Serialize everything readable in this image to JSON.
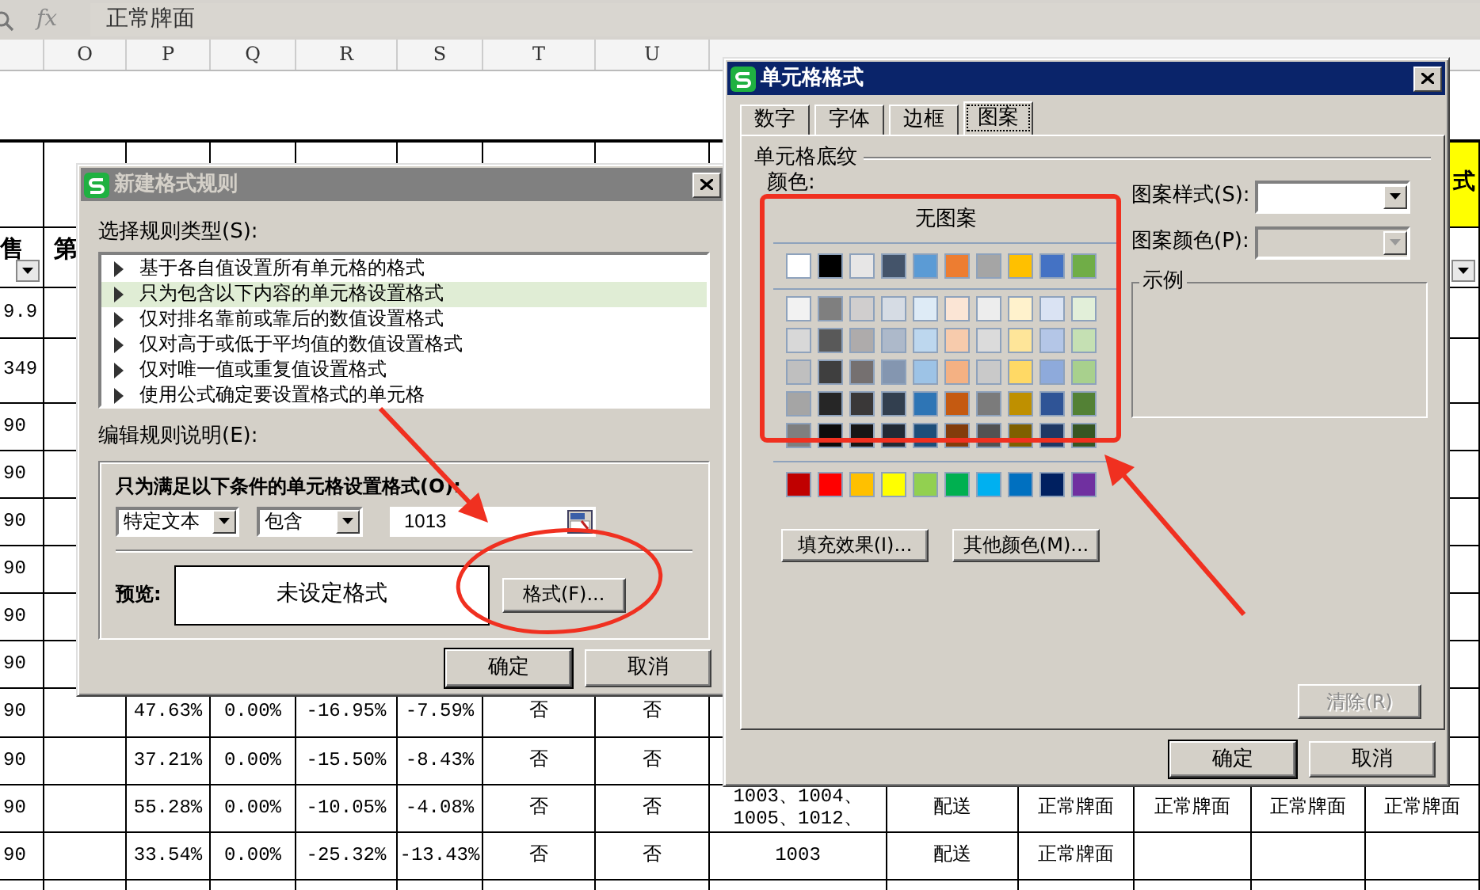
{
  "formula_bar": {
    "fx_label": "fx",
    "cell_value": "正常牌面"
  },
  "column_headers": [
    "O",
    "P",
    "Q",
    "R",
    "S",
    "T",
    "U"
  ],
  "sheet_rows": [
    {
      "kind": "data",
      "cells": [
        null,
        null,
        null,
        null,
        null,
        null,
        null,
        null,
        null,
        null,
        null,
        null,
        null,
        {
          "text": "式",
          "highlight": true
        }
      ]
    },
    {
      "kind": "header",
      "cells": [
        {
          "text": "售",
          "filter_button": true
        },
        {
          "text": "第",
          "filter_button": false
        },
        null,
        null,
        null,
        null,
        null,
        null,
        null,
        null,
        null,
        null,
        null,
        {
          "filter_button": true
        }
      ]
    },
    {
      "kind": "data",
      "cells": [
        {
          "text": "9.9"
        },
        null,
        null,
        null,
        null,
        null,
        null,
        null,
        null,
        null,
        null,
        null,
        null,
        null
      ]
    },
    {
      "kind": "data",
      "cells": [
        {
          "text": "349"
        },
        null,
        null,
        null,
        null,
        null,
        null,
        null,
        null,
        null,
        null,
        null,
        null,
        null
      ]
    },
    {
      "kind": "data",
      "cells": [
        {
          "text": "90"
        },
        null,
        null,
        null,
        null,
        null,
        null,
        null,
        null,
        null,
        null,
        null,
        null,
        null
      ]
    },
    {
      "kind": "data",
      "cells": [
        {
          "text": "90"
        },
        null,
        null,
        null,
        null,
        null,
        null,
        null,
        null,
        null,
        null,
        null,
        null,
        null
      ]
    },
    {
      "kind": "data",
      "cells": [
        {
          "text": "90"
        },
        null,
        null,
        null,
        null,
        null,
        null,
        null,
        null,
        null,
        null,
        null,
        null,
        null
      ]
    },
    {
      "kind": "data",
      "cells": [
        {
          "text": "90"
        },
        null,
        null,
        null,
        null,
        null,
        null,
        null,
        null,
        null,
        null,
        null,
        null,
        null
      ]
    },
    {
      "kind": "data",
      "cells": [
        {
          "text": "90"
        },
        null,
        null,
        null,
        null,
        null,
        null,
        null,
        null,
        null,
        null,
        null,
        null,
        null
      ]
    },
    {
      "kind": "data",
      "cells": [
        {
          "text": "90"
        },
        null,
        null,
        null,
        null,
        null,
        null,
        null,
        null,
        null,
        null,
        null,
        null,
        null
      ]
    },
    {
      "kind": "data",
      "cells": [
        {
          "text": "90"
        },
        null,
        {
          "text": "47.63%"
        },
        {
          "text": "0.00%"
        },
        {
          "text": "-16.95%"
        },
        {
          "text": "-7.59%"
        },
        {
          "text": "否"
        },
        {
          "text": "否"
        },
        null,
        null,
        null,
        null,
        null,
        null
      ]
    },
    {
      "kind": "data",
      "cells": [
        {
          "text": "90"
        },
        null,
        {
          "text": "37.21%"
        },
        {
          "text": "0.00%"
        },
        {
          "text": "-15.50%"
        },
        {
          "text": "-8.43%"
        },
        {
          "text": "否"
        },
        {
          "text": "否"
        },
        null,
        null,
        null,
        null,
        null,
        null
      ]
    },
    {
      "kind": "data",
      "cells": [
        {
          "text": "90"
        },
        null,
        {
          "text": "55.28%"
        },
        {
          "text": "0.00%"
        },
        {
          "text": "-10.05%"
        },
        {
          "text": "-4.08%"
        },
        {
          "text": "否"
        },
        {
          "text": "否"
        },
        {
          "text": "1003、1004、\n1005、1012、"
        },
        {
          "text": "配送"
        },
        {
          "text": "正常牌面"
        },
        {
          "text": "正常牌面"
        },
        {
          "text": "正常牌面"
        },
        {
          "text": "正常牌面"
        }
      ]
    },
    {
      "kind": "data",
      "cells": [
        {
          "text": "90"
        },
        null,
        {
          "text": "33.54%"
        },
        {
          "text": "0.00%"
        },
        {
          "text": "-25.32%"
        },
        {
          "text": "-13.43%"
        },
        {
          "text": "否"
        },
        {
          "text": "否"
        },
        {
          "text": "1003"
        },
        {
          "text": "配送"
        },
        {
          "text": "正常牌面"
        },
        null,
        null,
        null
      ]
    },
    {
      "kind": "data",
      "cells": [
        null,
        null,
        null,
        null,
        null,
        null,
        null,
        null,
        null,
        null,
        null,
        null,
        null,
        null
      ]
    }
  ],
  "rule_dialog": {
    "title": "新建格式规则",
    "active": false,
    "rule_type_label": "选择规则类型(S):",
    "rule_types": [
      {
        "label": "基于各自值设置所有单元格的格式",
        "selected": false
      },
      {
        "label": "只为包含以下内容的单元格设置格式",
        "selected": true
      },
      {
        "label": "仅对排名靠前或靠后的数值设置格式",
        "selected": false
      },
      {
        "label": "仅对高于或低于平均值的数值设置格式",
        "selected": false
      },
      {
        "label": "仅对唯一值或重复值设置格式",
        "selected": false
      },
      {
        "label": "使用公式确定要设置格式的单元格",
        "selected": false
      }
    ],
    "description_label": "编辑规则说明(E):",
    "condition_label": "只为满足以下条件的单元格设置格式(O):",
    "condition_type": "特定文本",
    "operator": "包含",
    "value": "1013",
    "preview_label": "预览:",
    "preview_text": "未设定格式",
    "format_button": "格式(F)...",
    "buttons": [
      "确定",
      "取消"
    ]
  },
  "cell_format_dialog": {
    "title": "单元格格式",
    "active": true,
    "tabs": [
      {
        "label": "数字",
        "selected": false
      },
      {
        "label": "字体",
        "selected": false
      },
      {
        "label": "边框",
        "selected": false
      },
      {
        "label": "图案",
        "selected": true
      }
    ],
    "shading_group": "单元格底纹",
    "color_label": "颜色:",
    "palette": {
      "no_pattern": "无图案",
      "theme_colors": [
        {
          "color": "#ffffff"
        },
        {
          "color": "#000000"
        },
        {
          "color": "#e7e6e6"
        },
        {
          "color": "#44546a"
        },
        {
          "color": "#5b9bd5"
        },
        {
          "color": "#ed7d31"
        },
        {
          "color": "#a5a5a5"
        },
        {
          "color": "#ffc000"
        },
        {
          "color": "#4472c4"
        },
        {
          "color": "#70ad47"
        }
      ],
      "shade_rows": [
        {
          "swatches": [
            {
              "color": "#f2f2f2"
            },
            {
              "color": "#7f7f7f"
            },
            {
              "color": "#d0cece"
            },
            {
              "color": "#d6dce4"
            },
            {
              "color": "#deebf6"
            },
            {
              "color": "#fbe5d5"
            },
            {
              "color": "#ededed"
            },
            {
              "color": "#fff2cc"
            },
            {
              "color": "#dae3f3"
            },
            {
              "color": "#e2efd9"
            }
          ]
        },
        {
          "swatches": [
            {
              "color": "#d8d8d8"
            },
            {
              "color": "#595959"
            },
            {
              "color": "#aeabab"
            },
            {
              "color": "#adb9ca"
            },
            {
              "color": "#bdd7ee"
            },
            {
              "color": "#f7cbac"
            },
            {
              "color": "#dbdbdb"
            },
            {
              "color": "#fee599"
            },
            {
              "color": "#b4c6e7"
            },
            {
              "color": "#c5e0b3"
            }
          ]
        },
        {
          "swatches": [
            {
              "color": "#bfbfbf"
            },
            {
              "color": "#3f3f3f"
            },
            {
              "color": "#757070"
            },
            {
              "color": "#8496b0"
            },
            {
              "color": "#9dc3e6"
            },
            {
              "color": "#f4b183"
            },
            {
              "color": "#c9c9c9"
            },
            {
              "color": "#ffd965"
            },
            {
              "color": "#8eaadb"
            },
            {
              "color": "#a8d08d"
            }
          ]
        },
        {
          "swatches": [
            {
              "color": "#a5a5a5"
            },
            {
              "color": "#262626"
            },
            {
              "color": "#3a3838"
            },
            {
              "color": "#323f4f"
            },
            {
              "color": "#2e75b5"
            },
            {
              "color": "#c55a11"
            },
            {
              "color": "#7b7b7b"
            },
            {
              "color": "#bf9000"
            },
            {
              "color": "#2f5496"
            },
            {
              "color": "#538135"
            }
          ]
        },
        {
          "swatches": [
            {
              "color": "#7f7f7f"
            },
            {
              "color": "#0c0c0c"
            },
            {
              "color": "#171616"
            },
            {
              "color": "#222a35"
            },
            {
              "color": "#1e4e79"
            },
            {
              "color": "#833c0b"
            },
            {
              "color": "#525252"
            },
            {
              "color": "#7f6000"
            },
            {
              "color": "#1f3864"
            },
            {
              "color": "#375623"
            }
          ]
        }
      ],
      "standard_colors": [
        {
          "color": "#c00000"
        },
        {
          "color": "#ff0000"
        },
        {
          "color": "#ffc000"
        },
        {
          "color": "#ffff00"
        },
        {
          "color": "#92d050"
        },
        {
          "color": "#00b050"
        },
        {
          "color": "#00b0f0"
        },
        {
          "color": "#0070c0"
        },
        {
          "color": "#002060"
        },
        {
          "color": "#7030a0"
        }
      ]
    },
    "fill_effects_button": "填充效果(I)...",
    "more_colors_button": "其他颜色(M)...",
    "pattern_style": {
      "label": "图案样式(S):",
      "disabled": false
    },
    "pattern_color": {
      "label": "图案颜色(P):",
      "disabled": true
    },
    "sample_label": "示例",
    "clear_button": {
      "label": "清除(R)",
      "disabled": true
    },
    "buttons": [
      "确定",
      "取消"
    ]
  }
}
